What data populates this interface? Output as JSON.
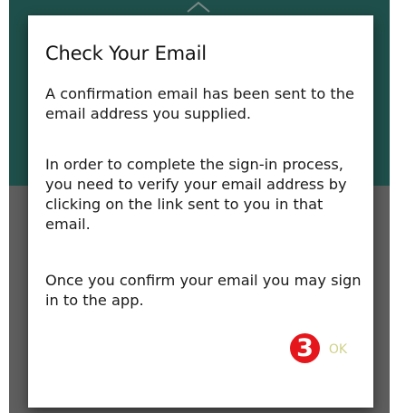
{
  "dialog": {
    "title": "Check Your Email",
    "paragraphs": [
      "A confirmation email has been sent to the email address you supplied.",
      "In order to complete the sign-in process, you need to verify your email address by clicking on the link sent to you in that email.",
      "Once you confirm your email you may sign in to the app."
    ],
    "ok_label": "OK"
  },
  "annotation": {
    "marker_label": "3"
  },
  "colors": {
    "backdrop_top": "#1f4f4a",
    "backdrop_bottom": "#5e5e5e",
    "dialog_background": "#ffffff",
    "ok_text": "#cfd38a",
    "marker": "#e5171c"
  },
  "icons": {
    "backdrop": "chevron-up-icon"
  }
}
